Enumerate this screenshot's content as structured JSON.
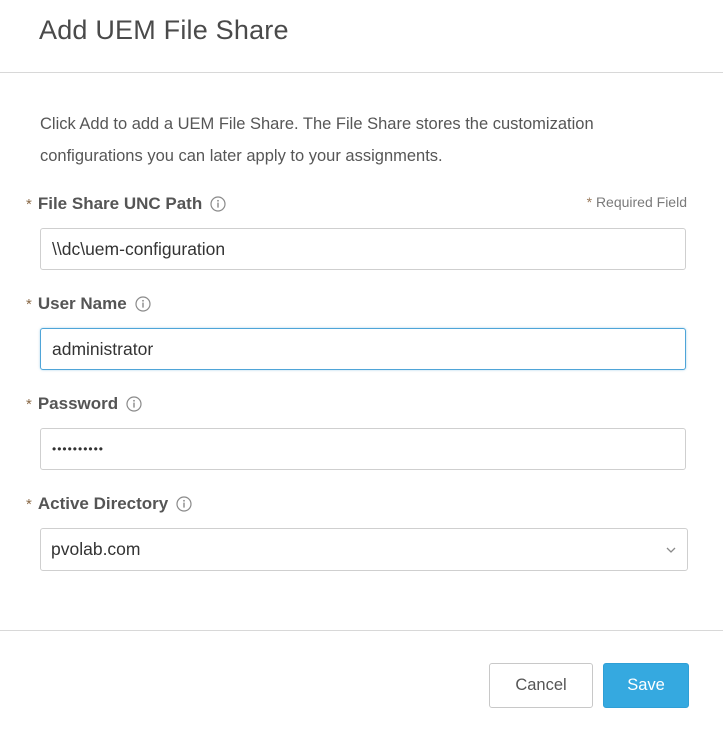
{
  "dialog": {
    "title": "Add UEM File Share",
    "intro_line1": "Click Add to add a UEM File Share. The File Share stores the customization",
    "intro_line2": "configurations you can later apply to your assignments.",
    "required_star": "*",
    "required_note": "Required Field"
  },
  "fields": {
    "unc_path": {
      "label": "File Share UNC Path",
      "value": "\\\\dc\\uem-configuration"
    },
    "user_name": {
      "label": "User Name",
      "value": "administrator"
    },
    "password": {
      "label": "Password",
      "value": "••••••••••"
    },
    "active_directory": {
      "label": "Active Directory",
      "selected": "pvolab.com"
    }
  },
  "footer": {
    "cancel_label": "Cancel",
    "save_label": "Save"
  },
  "colors": {
    "primary": "#35a9e0",
    "focus_border": "#4fa5d8",
    "required_star": "#8a6a48"
  },
  "icons": {
    "info": "info-icon",
    "dropdown": "chevron-down-icon"
  }
}
